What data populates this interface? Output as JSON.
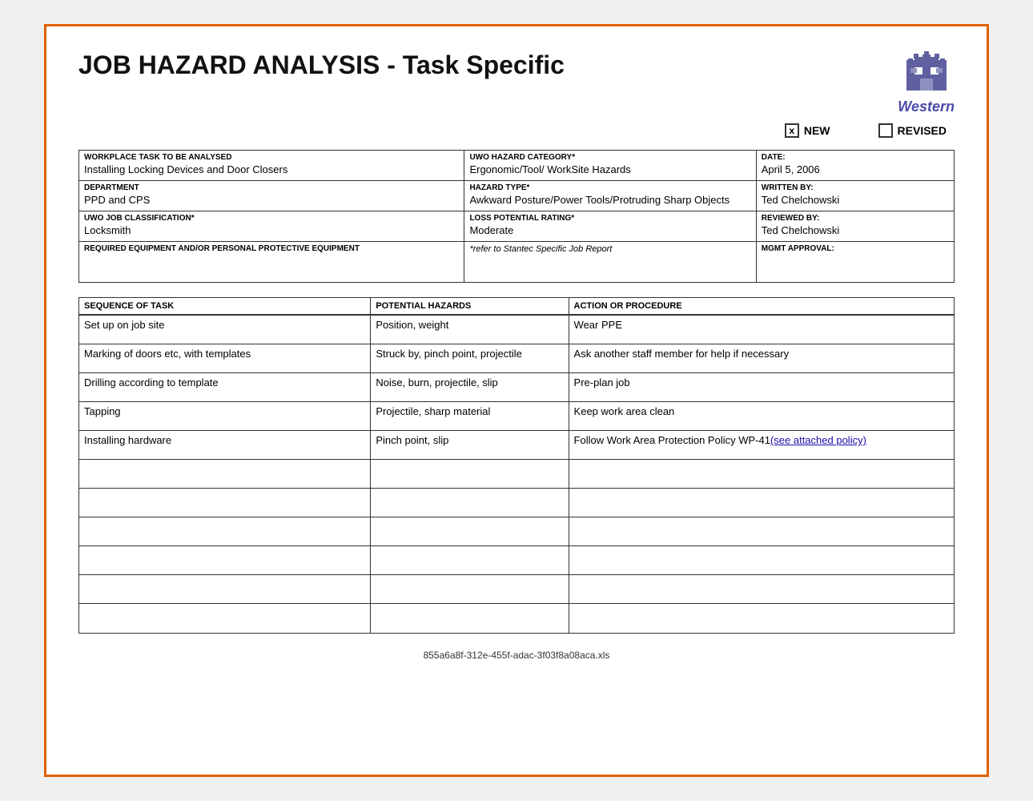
{
  "title": "JOB HAZARD ANALYSIS - Task Specific",
  "logo": {
    "text": "Western"
  },
  "status": {
    "new_label": "NEW",
    "new_checked": true,
    "revised_label": "REVISED",
    "revised_checked": false
  },
  "form": {
    "workplace_task_label": "WORKPLACE TASK TO BE ANALYSED",
    "workplace_task_value": "Installing Locking Devices and Door Closers",
    "department_label": "DEPARTMENT",
    "department_value": "PPD and CPS",
    "uwo_job_label": "UWO JOB CLASSIFICATION*",
    "uwo_job_value": "Locksmith",
    "required_equip_label": "REQUIRED EQUIPMENT AND/OR PERSONAL PROTECTIVE EQUIPMENT",
    "required_equip_value": "",
    "uwo_hazard_label": "UWO HAZARD CATEGORY*",
    "uwo_hazard_value": "Ergonomic/Tool/ WorkSite Hazards",
    "hazard_type_label": "HAZARD TYPE*",
    "hazard_type_value": "Awkward Posture/Power Tools/Protruding Sharp Objects",
    "loss_potential_label": "LOSS POTENTIAL RATING*",
    "loss_potential_value": "Moderate",
    "refer_label": "*refer to Stantec Specific Job Report",
    "date_label": "DATE:",
    "date_value": "April 5, 2006",
    "written_by_label": "WRITTEN BY:",
    "written_by_value": "Ted Chelchowski",
    "reviewed_by_label": "REVIEWED BY:",
    "reviewed_by_value": "Ted Chelchowski",
    "mgmt_label": "MGMT APPROVAL:",
    "mgmt_value": ""
  },
  "tasks_table": {
    "col_seq": "SEQUENCE OF TASK",
    "col_haz": "POTENTIAL HAZARDS",
    "col_act": "ACTION OR PROCEDURE",
    "rows": [
      {
        "seq": "Set up on job site",
        "haz": "Position, weight",
        "act": "Wear PPE"
      },
      {
        "seq": "Marking of doors etc, with templates",
        "haz": "Struck by, pinch point, projectile",
        "act": "Ask another staff member for help if necessary"
      },
      {
        "seq": "Drilling according to template",
        "haz": "Noise, burn, projectile, slip",
        "act": "Pre-plan job"
      },
      {
        "seq": "Tapping",
        "haz": "Projectile, sharp material",
        "act": "Keep work area clean"
      },
      {
        "seq": "Installing hardware",
        "haz": "Pinch point, slip",
        "act": "Follow Work Area Protection Policy WP-41\n(see attached policy)",
        "act_link": true
      },
      {
        "seq": "",
        "haz": "",
        "act": ""
      },
      {
        "seq": "",
        "haz": "",
        "act": ""
      },
      {
        "seq": "",
        "haz": "",
        "act": ""
      },
      {
        "seq": "",
        "haz": "",
        "act": ""
      },
      {
        "seq": "",
        "haz": "",
        "act": ""
      },
      {
        "seq": "",
        "haz": "",
        "act": ""
      }
    ]
  },
  "footer": {
    "filename": "855a6a8f-312e-455f-adac-3f03f8a08aca.xls"
  }
}
